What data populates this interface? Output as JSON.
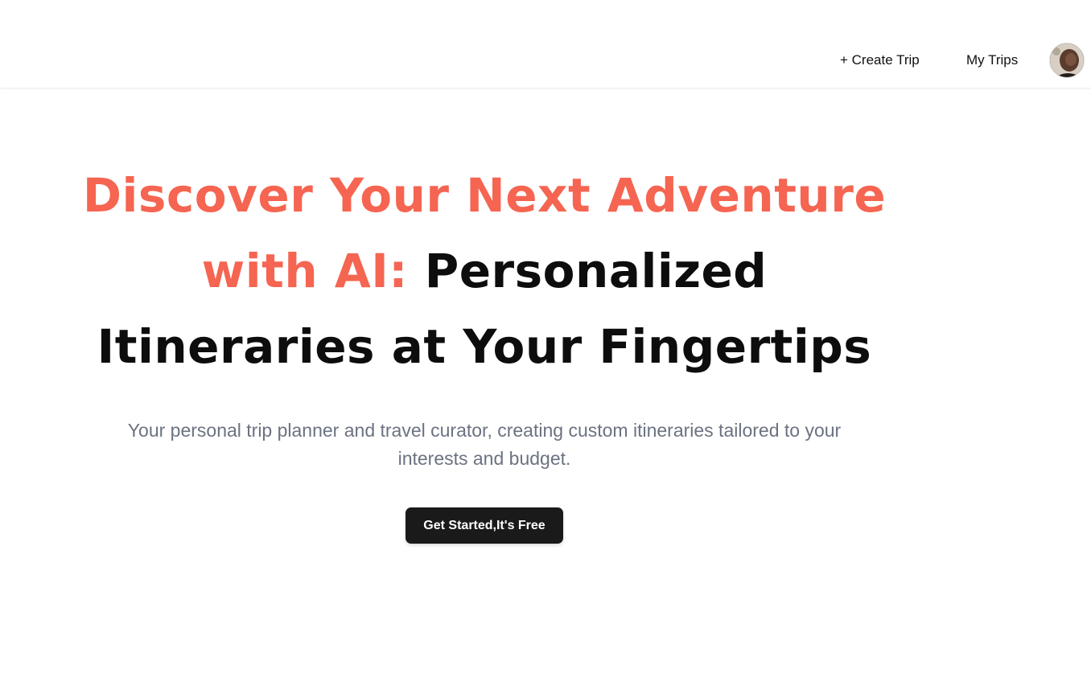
{
  "header": {
    "create_trip_label": "+ Create Trip",
    "my_trips_label": "My Trips",
    "avatar": "user-avatar"
  },
  "hero": {
    "title_accent": "Discover Your Next Adventure with AI:",
    "title_rest": "Personalized Itineraries at Your Fingertips",
    "subtitle": "Your personal trip planner and travel curator, creating custom itineraries tailored to your interests and budget.",
    "cta_label": "Get Started,It's Free"
  },
  "colors": {
    "accent": "#f56551",
    "title_dark": "#0d0d0d",
    "subtitle_gray": "#6b7280",
    "button_bg": "#1a1a1a"
  }
}
